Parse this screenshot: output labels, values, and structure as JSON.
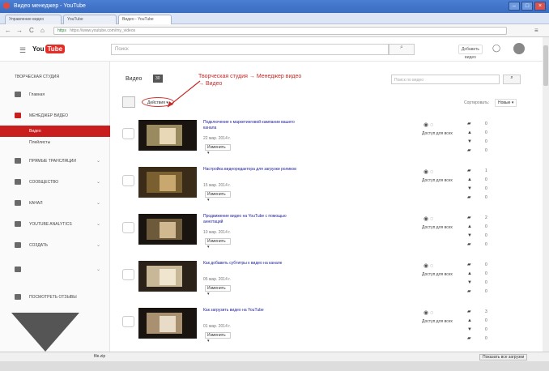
{
  "window": {
    "title": "Видео менеджер - YouTube",
    "controls": [
      "–",
      "□",
      "×"
    ]
  },
  "browser": {
    "tabs": [
      {
        "label": "Управление видео"
      },
      {
        "label": "YouTube"
      },
      {
        "label": "Видео - YouTube"
      }
    ],
    "url": "https://www.youtube.com/my_videos",
    "secure_label": "https",
    "nav": {
      "back": "←",
      "forward": "→",
      "reload": "C",
      "home": "⌂"
    },
    "menu_icon": "≡"
  },
  "header": {
    "logo_you": "You",
    "logo_tube": "Tube",
    "search_placeholder": "Поиск",
    "upload_label": "Добавить видео"
  },
  "sidebar": {
    "items": [
      {
        "label": "ТВОРЧЕСКАЯ СТУДИЯ"
      },
      {
        "label": "Главная"
      },
      {
        "label": "МЕНЕДЖЕР ВИДЕО"
      },
      {
        "label": "Видео"
      },
      {
        "label": "Плейлисты"
      },
      {
        "label": "ПРЯМЫЕ ТРАНСЛЯЦИИ"
      },
      {
        "label": "СООБЩЕСТВО"
      },
      {
        "label": "КАНАЛ"
      },
      {
        "label": "YOUTUBE ANALYTICS"
      },
      {
        "label": "СОЗДАТЬ"
      },
      {
        "label": "ПОСМОТРЕТЬ ОТЗЫВЫ"
      }
    ]
  },
  "main": {
    "title": "Видео",
    "count": "30",
    "annotation": "Творческая студия → Менеджер видео → Видео",
    "search_placeholder": "Поиск по видео",
    "actions_label": "Действия",
    "sort_label": "Сортировать:",
    "sort_value": "Новые"
  },
  "videos": [
    {
      "title": "Подключение к маркетинговой кампании вашего канала",
      "date": "22 мар. 2014 г.",
      "edit": "Изменить",
      "visibility": "Доступ для всех",
      "views": "0",
      "likes": "0",
      "dislikes": "0",
      "comments": "0"
    },
    {
      "title": "Настройка видеоредактора для загрузки роликов",
      "date": "15 мар. 2014 г.",
      "edit": "Изменить",
      "visibility": "Доступ для всех",
      "views": "1",
      "likes": "0",
      "dislikes": "0",
      "comments": "0"
    },
    {
      "title": "Продвижение видео на YouTube с помощью аннотаций",
      "date": "10 мар. 2014 г.",
      "edit": "Изменить",
      "visibility": "Доступ для всех",
      "views": "2",
      "likes": "0",
      "dislikes": "0",
      "comments": "0"
    },
    {
      "title": "Как добавить субтитры к видео на канале",
      "date": "05 мар. 2014 г.",
      "edit": "Изменить",
      "visibility": "Доступ для всех",
      "views": "0",
      "likes": "0",
      "dislikes": "0",
      "comments": "0"
    },
    {
      "title": "Как загрузить видео на YouTube",
      "date": "01 мар. 2014 г.",
      "edit": "Изменить",
      "visibility": "Доступ для всех",
      "views": "3",
      "likes": "0",
      "dislikes": "0",
      "comments": "0"
    }
  ],
  "statusbar": {
    "download_label": "file.zip",
    "show_all": "Показать все загрузки"
  },
  "colors": {
    "accent": "#c81e1e",
    "annotation": "#c72a2a",
    "redact": "#e2231a",
    "titlebar": "#4b7fd3"
  }
}
